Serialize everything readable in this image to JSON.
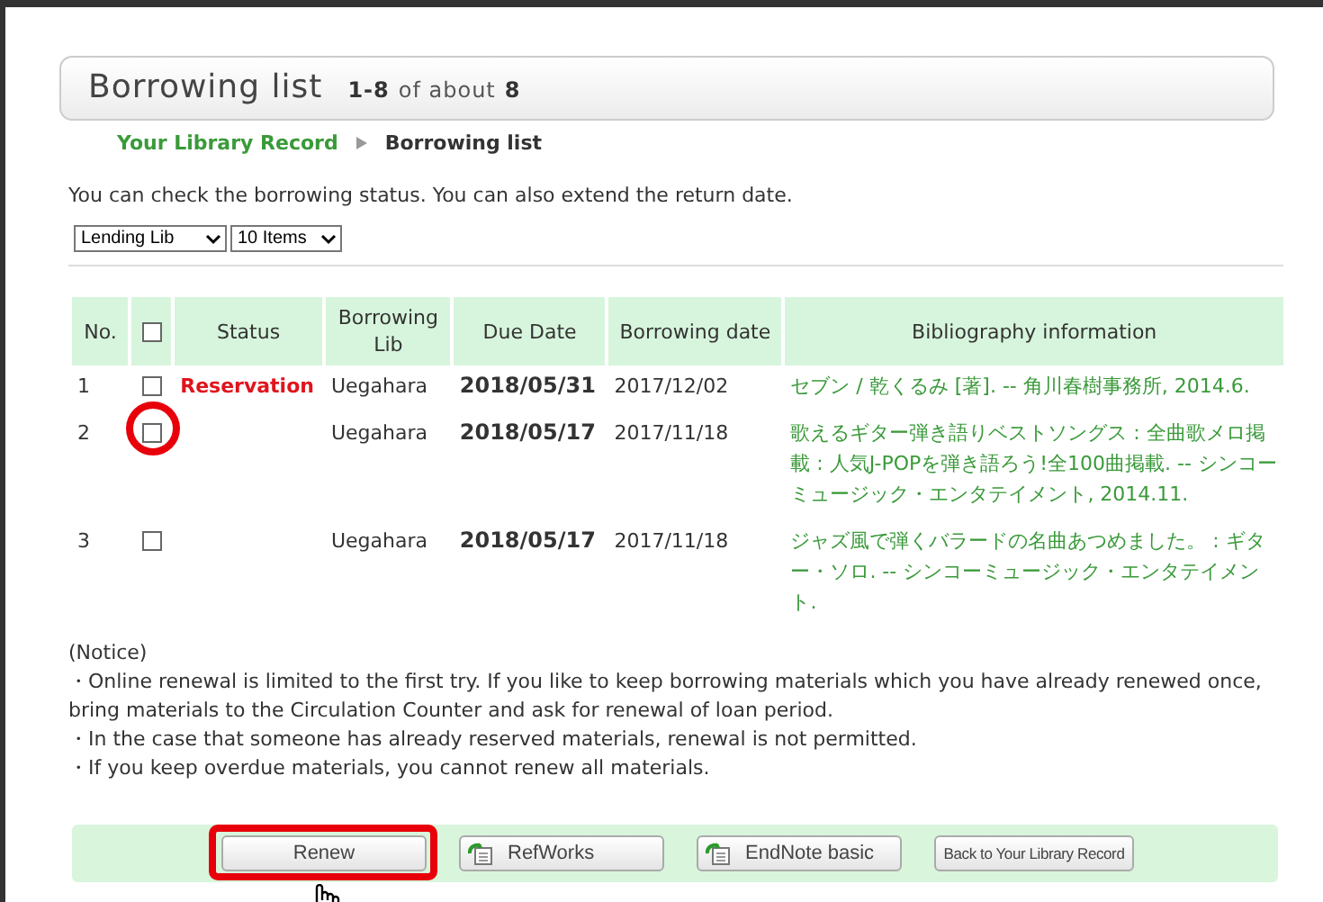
{
  "header": {
    "title": "Borrowing list",
    "range": "1-8",
    "of_about": "of about",
    "total": "8"
  },
  "breadcrumb": [
    {
      "label": "Your Library Record",
      "link": true
    },
    {
      "label": "Borrowing list",
      "link": false
    }
  ],
  "intro": "You can check the borrowing status. You can also extend the return date.",
  "filters": [
    {
      "value": "Lending Lib"
    },
    {
      "value": "10 Items"
    }
  ],
  "table": {
    "columns": [
      "No.",
      "",
      "Status",
      "Borrowing Lib",
      "Due Date",
      "Borrowing date",
      "Bibliography information"
    ],
    "select_all": {
      "checked": false
    },
    "rows": [
      {
        "no": "1",
        "checked": false,
        "highlighted": false,
        "status": "Reservation",
        "lib": "Uegahara",
        "due": "2018/05/31",
        "borrowed": "2017/12/02",
        "bibliography": "セブン / 乾くるみ [著]. -- 角川春樹事務所, 2014.6."
      },
      {
        "no": "2",
        "checked": false,
        "highlighted": true,
        "lib": "Uegahara",
        "due": "2018/05/17",
        "borrowed": "2017/11/18",
        "bibliography": "歌えるギター弾き語りベストソングス : 全曲歌メロ掲載 : 人気J-POPを弾き語ろう!全100曲掲載. -- シンコーミュージック・エンタテイメント, 2014.11."
      },
      {
        "no": "3",
        "checked": false,
        "highlighted": false,
        "lib": "Uegahara",
        "due": "2018/05/17",
        "borrowed": "2017/11/18",
        "bibliography": "ジャズ風で弾くバラードの名曲あつめました。 : ギター・ソロ. -- シンコーミュージック・エンタテイメント."
      }
    ]
  },
  "notice": {
    "heading": "(Notice)",
    "items": [
      "・Online renewal is limited to the first try. If you like to keep borrowing materials which you have already renewed once, bring materials to the Circulation Counter and ask for renewal of loan period.",
      "・In the case that someone has already reserved materials, renewal is not permitted.",
      "・If you keep overdue materials, you cannot renew all materials."
    ]
  },
  "buttons": [
    {
      "label": "Renew",
      "kind": "plain",
      "highlighted": true,
      "pointer": true
    },
    {
      "label": "RefWorks",
      "kind": "export",
      "highlighted": false,
      "pointer": false
    },
    {
      "label": "EndNote basic",
      "kind": "export",
      "highlighted": false,
      "pointer": false
    },
    {
      "label": "Back to Your Library Record",
      "kind": "small",
      "highlighted": false,
      "pointer": false
    }
  ]
}
